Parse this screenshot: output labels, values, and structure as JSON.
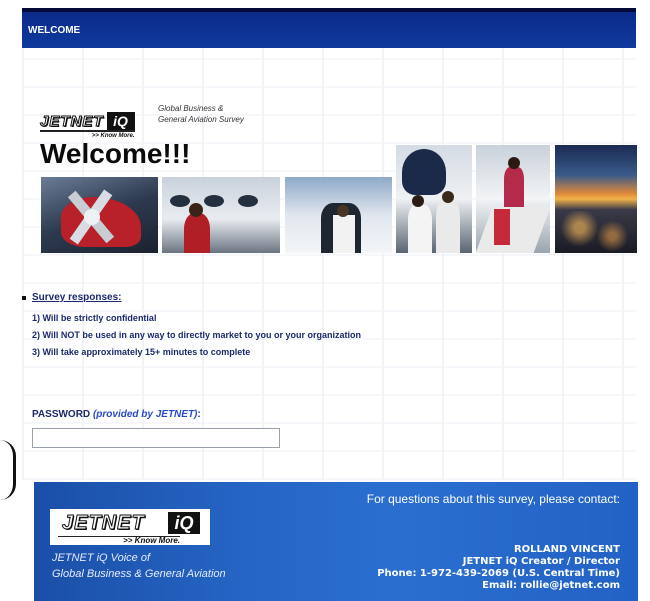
{
  "header": {
    "title": "WELCOME"
  },
  "brand": {
    "logo_word": "JETNET",
    "logo_iq": "iQ",
    "tagline": ">> Know More.",
    "survey_line1": "Global Business &",
    "survey_line2": "General Aviation Survey"
  },
  "welcome": "Welcome!!!",
  "photos": [
    {
      "name": "propeller-aircraft-photo"
    },
    {
      "name": "jet-windows-passenger-photo"
    },
    {
      "name": "boarding-jet-door-photo"
    },
    {
      "name": "crew-at-jet-nose-photo"
    },
    {
      "name": "passengers-on-stairs-photo"
    },
    {
      "name": "city-sunset-aerial-photo"
    }
  ],
  "survey": {
    "heading": "Survey responses",
    "heading_suffix": ":",
    "items": [
      "1) Will be strictly confidential",
      "2) Will NOT be used in any way to directly market to you or your organization",
      "3) Will take approximately 15+ minutes to complete"
    ]
  },
  "password": {
    "label": "PASSWORD",
    "hint": "(provided by JETNET)",
    "suffix": ":",
    "value": "",
    "placeholder": ""
  },
  "footer": {
    "question": "For questions about this survey, please contact:",
    "voice_line1": "JETNET iQ Voice of",
    "voice_line2": "Global Business & General Aviation",
    "contact_name": "ROLLAND VINCENT",
    "contact_title": "JETNET iQ Creator / Director",
    "contact_phone": "Phone: 1-972-439-2069 (U.S. Central Time)",
    "contact_email": "Email: rollie@jetnet.com"
  },
  "colors": {
    "header_blue": "#0a2a8a",
    "text_navy": "#1a2a6c",
    "footer_blue": "#2565c4",
    "hint_blue": "#2a48c8"
  }
}
